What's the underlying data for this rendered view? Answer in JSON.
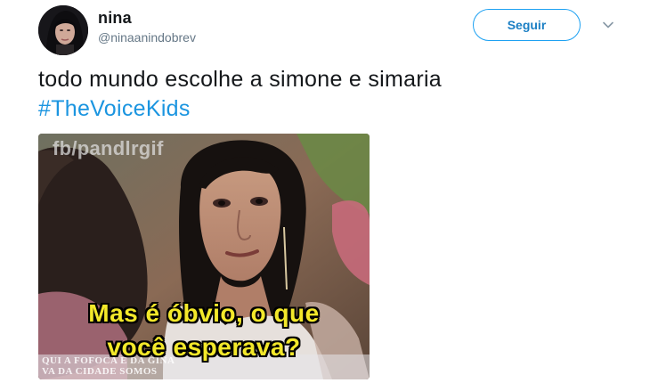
{
  "user": {
    "name": "nina",
    "handle": "@ninaanindobrev"
  },
  "follow_button": {
    "label": "Seguir"
  },
  "menu": {
    "icon": "chevron-down-icon"
  },
  "tweet": {
    "text": "todo mundo escolhe a simone e simaria",
    "hashtag": "#TheVoiceKids"
  },
  "media": {
    "watermark": "fb/pandlrgif",
    "subtitle_line1": "Mas é óbvio, o que",
    "subtitle_line2": "você esperava?",
    "ticker_line1": "QUI A FOFOCA E DA GINA",
    "ticker_line2": "VA DA CIDADE SOMOS"
  },
  "colors": {
    "accent": "#1da1f2",
    "hashtag": "#1b95e0",
    "subtitle": "#f3e82a"
  }
}
